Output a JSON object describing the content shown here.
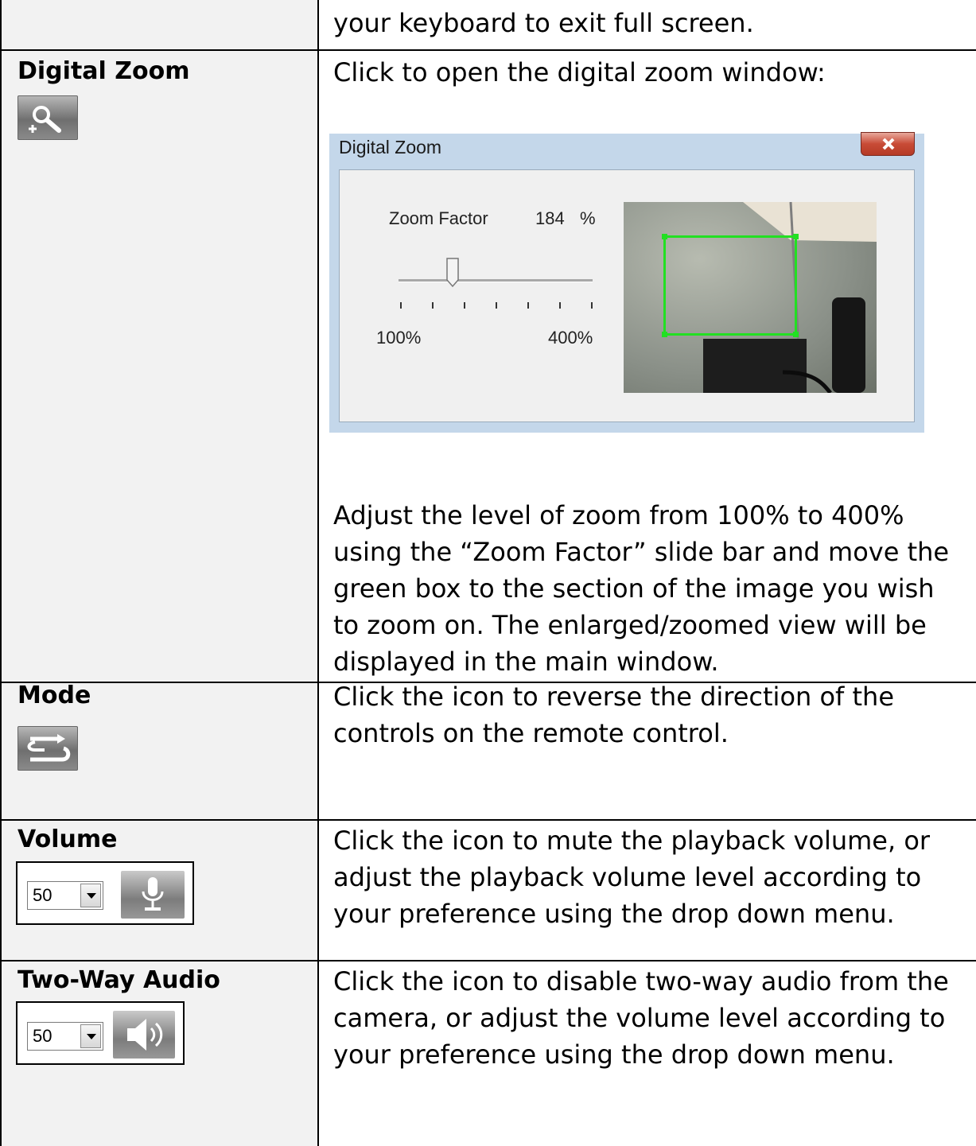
{
  "rows": {
    "top": {
      "desc": "your keyboard to exit full screen."
    },
    "digital_zoom": {
      "label": "Digital Zoom",
      "icon": "zoom-in-magnifier-icon",
      "desc_intro": "Click to open the digital zoom window:",
      "desc_body": "Adjust the level of zoom from 100% to 400% using the “Zoom Factor” slide bar and move the green box to the section of the image you wish to zoom on. The enlarged/zoomed view will be displayed in the main window.",
      "window": {
        "title": "Digital Zoom",
        "close_icon": "close-x-icon",
        "zoom_factor_label": "Zoom Factor",
        "zoom_value": "184",
        "zoom_unit": "%",
        "slider_min_label": "100%",
        "slider_max_label": "400%",
        "slider_min": 100,
        "slider_max": 400,
        "slider_value": 184,
        "box_color": "#22e022"
      }
    },
    "mode": {
      "label": "Mode",
      "icon": "reverse-direction-icon",
      "desc": "Click the icon to reverse the direction of the controls on the remote control."
    },
    "volume": {
      "label": "Volume",
      "select_value": "50",
      "icon": "microphone-icon",
      "desc": "Click the icon to mute the playback volume, or adjust the playback volume level according to your preference using the drop down menu."
    },
    "two_way_audio": {
      "label": "Two-Way Audio",
      "select_value": "50",
      "icon": "speaker-icon",
      "desc": "Click the icon to disable two-way audio from the camera, or adjust the volume level according to your preference using the drop down menu."
    }
  }
}
